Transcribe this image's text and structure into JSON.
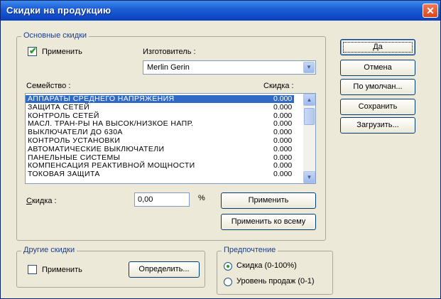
{
  "window": {
    "title": "Скидки на продукцию",
    "close_glyph": "✕"
  },
  "main_discounts": {
    "legend": "Основные скидки",
    "apply_label": "Применить",
    "apply_checked": true,
    "manufacturer_label": "Изготовитель :",
    "manufacturer_value": "Merlin Gerin"
  },
  "families": {
    "family_header": "Семейство :",
    "discount_header": "Скидка :",
    "rows": [
      {
        "name": "АППАРАТЫ СРЕДНЕГО НАПРЯЖЕНИЯ",
        "discount": "0.000",
        "selected": true
      },
      {
        "name": "ЗАЩИТА СЕТЕЙ",
        "discount": "0.000",
        "selected": false
      },
      {
        "name": "КОНТРОЛЬ СЕТЕЙ",
        "discount": "0.000",
        "selected": false
      },
      {
        "name": "МАСЛ. ТРАН-РЫ НА ВЫСОК/НИЗКОЕ НАПР.",
        "discount": "0.000",
        "selected": false
      },
      {
        "name": "ВЫКЛЮЧАТЕЛИ ДО 630А",
        "discount": "0.000",
        "selected": false
      },
      {
        "name": "КОНТРОЛЬ УСТАНОВКИ",
        "discount": "0.000",
        "selected": false
      },
      {
        "name": "АВТОМАТИЧЕСКИЕ ВЫКЛЮЧАТЕЛИ",
        "discount": "0.000",
        "selected": false
      },
      {
        "name": "ПАНЕЛЬНЫЕ СИСТЕМЫ",
        "discount": "0.000",
        "selected": false
      },
      {
        "name": "КОМПЕНСАЦИЯ РЕАКТИВНОЙ МОЩНОСТИ",
        "discount": "0.000",
        "selected": false
      },
      {
        "name": "ТОКОВАЯ ЗАЩИТА",
        "discount": "0.000",
        "selected": false
      }
    ]
  },
  "discount_edit": {
    "label": "Скидка :",
    "value": "0,00",
    "unit": "%",
    "apply_button": "Применить",
    "apply_all_button": "Применить ко всему"
  },
  "other_discounts": {
    "legend": "Другие скидки",
    "apply_label": "Применить",
    "apply_checked": false,
    "define_button": "Определить..."
  },
  "preference": {
    "legend": "Предпочтение",
    "options": [
      {
        "label": "Скидка (0-100%)",
        "selected": true
      },
      {
        "label": "Уровень продаж (0-1)",
        "selected": false
      }
    ]
  },
  "side_buttons": {
    "yes": "Да",
    "cancel": "Отмена",
    "default": "По умолчан...",
    "save": "Сохранить",
    "load": "Загрузить..."
  },
  "icons": {
    "check": "check-icon",
    "dropdown": "chevron-down-icon",
    "scroll_up": "chevron-up-icon",
    "scroll_down": "chevron-down-icon"
  }
}
